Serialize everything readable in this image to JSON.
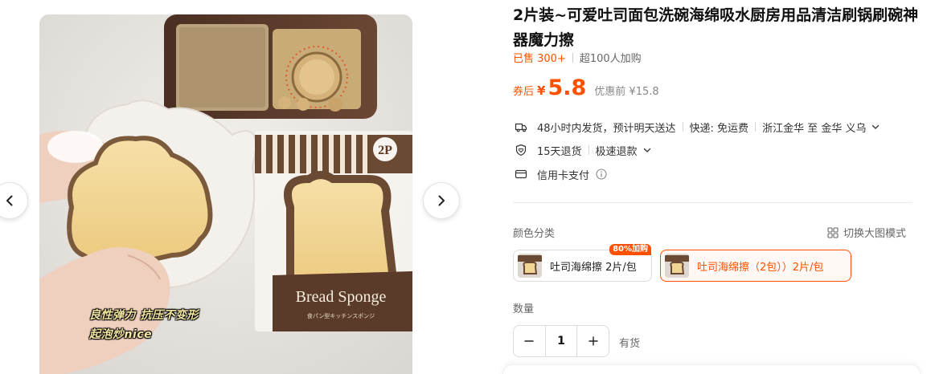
{
  "gallery": {
    "caption_line1": "良性弹力 抗压不变形",
    "caption_line2": "起泡炒nice",
    "package_badge": "2P",
    "package_text": "Bread Sponge",
    "package_subtext": "食パン型キッチンスポンジ"
  },
  "product": {
    "title": "2片装~可爱吐司面包洗碗海绵吸水厨房用品清洁刷锅刷碗神器魔力擦",
    "sold": "已售 300+",
    "buyers": "超100人加购",
    "coupon_label": "券后",
    "currency": "¥",
    "price": "5.8",
    "original_price": "优惠前 ¥15.8"
  },
  "services": {
    "shipping": "48小时内发货，预计明天送达",
    "freight": "快递: 免运费",
    "route": "浙江金华 至 金华 义乌",
    "returns": "15天退货",
    "refund": "极速退款",
    "payment": "信用卡支付"
  },
  "options": {
    "color_label": "颜色分类",
    "switch_mode": "切换大图模式",
    "skus": [
      {
        "label": "吐司海绵擦 2片/包",
        "badge": "80%加购",
        "selected": false
      },
      {
        "label": "吐司海绵擦（2包））2片/包",
        "selected": true
      }
    ],
    "quantity_label": "数量",
    "quantity": "1",
    "stock": "有货"
  },
  "colors": {
    "accent": "#ff5000",
    "text": "#111111",
    "muted": "#666666"
  }
}
